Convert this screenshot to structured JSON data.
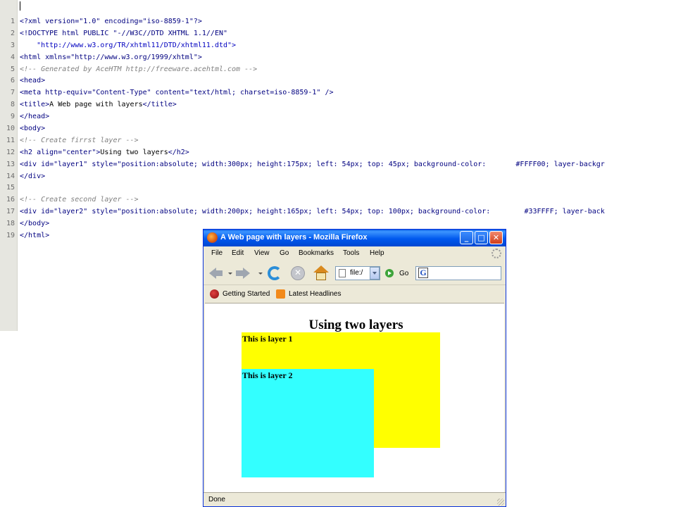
{
  "editor": {
    "lines": [
      {
        "n": "1",
        "parts": [
          {
            "cls": "c-tag",
            "t": "<?xml version=\"1.0\" encoding=\"iso-8859-1\"?>"
          }
        ]
      },
      {
        "n": "2",
        "parts": [
          {
            "cls": "c-tag",
            "t": "<!DOCTYPE html PUBLIC \"-//W3C//DTD XHTML 1.1//EN\""
          }
        ]
      },
      {
        "n": "3",
        "parts": [
          {
            "cls": "c-str",
            "t": "    \"http://www.w3.org/TR/xhtml11/DTD/xhtml11.dtd\">"
          }
        ]
      },
      {
        "n": "4",
        "parts": [
          {
            "cls": "c-tag",
            "t": "<html xmlns=\"http://www.w3.org/1999/xhtml\">"
          }
        ]
      },
      {
        "n": "5",
        "parts": [
          {
            "cls": "c-com",
            "t": "<!-- Generated by AceHTM http://freeware.acehtml.com -->"
          }
        ]
      },
      {
        "n": "6",
        "parts": [
          {
            "cls": "c-tag",
            "t": "<head>"
          }
        ]
      },
      {
        "n": "7",
        "parts": [
          {
            "cls": "c-tag",
            "t": "<meta http-equiv=\"Content-Type\" content=\"text/html; charset=iso-8859-1\" />"
          }
        ]
      },
      {
        "n": "8",
        "parts": [
          {
            "cls": "c-tag",
            "t": "<title>"
          },
          {
            "cls": "c-txt",
            "t": "A Web page with layers"
          },
          {
            "cls": "c-tag",
            "t": "</title>"
          }
        ]
      },
      {
        "n": "9",
        "parts": [
          {
            "cls": "c-tag",
            "t": "</head>"
          }
        ]
      },
      {
        "n": "10",
        "parts": [
          {
            "cls": "c-tag",
            "t": "<body>"
          }
        ]
      },
      {
        "n": "11",
        "parts": [
          {
            "cls": "c-com",
            "t": "<!-- Create firrst layer -->"
          }
        ]
      },
      {
        "n": "12",
        "parts": [
          {
            "cls": "c-tag",
            "t": "<h2 align=\"center\">"
          },
          {
            "cls": "c-txt",
            "t": "Using two layers"
          },
          {
            "cls": "c-tag",
            "t": "</h2>"
          }
        ]
      },
      {
        "n": "13",
        "parts": [
          {
            "cls": "c-tag",
            "t": "<div id=\"layer1\" style=\"position:absolute; width:300px; height:175px; left: 54px; top: 45px; background-color:       #FFFF00; layer-backgr"
          }
        ]
      },
      {
        "n": "14",
        "parts": [
          {
            "cls": "c-tag",
            "t": "</div>"
          }
        ]
      },
      {
        "n": "15",
        "parts": [
          {
            "cls": "c-txt",
            "t": ""
          }
        ]
      },
      {
        "n": "16",
        "parts": [
          {
            "cls": "c-com",
            "t": "<!-- Create second layer -->"
          }
        ]
      },
      {
        "n": "17",
        "parts": [
          {
            "cls": "c-tag",
            "t": "<div id=\"layer2\" style=\"position:absolute; width:200px; height:165px; left: 54px; top: 100px; background-color:        #33FFFF; layer-back"
          }
        ]
      },
      {
        "n": "18",
        "parts": [
          {
            "cls": "c-tag",
            "t": "</body>"
          }
        ]
      },
      {
        "n": "19",
        "parts": [
          {
            "cls": "c-tag",
            "t": "</html>"
          }
        ]
      }
    ]
  },
  "browser": {
    "title": "A Web page with layers - Mozilla Firefox",
    "window_buttons": {
      "minimize": "_",
      "maximize": "□",
      "close": "✕"
    },
    "menu": [
      "File",
      "Edit",
      "View",
      "Go",
      "Bookmarks",
      "Tools",
      "Help"
    ],
    "url": "file:/",
    "go_label": "Go",
    "search_icon_letter": "G",
    "stop_symbol": "✕",
    "bookmarks": [
      {
        "label": "Getting Started",
        "icon": "firefox-icon"
      },
      {
        "label": "Latest Headlines",
        "icon": "rss-icon"
      }
    ],
    "page": {
      "heading": "Using two layers",
      "layer1": {
        "text": "This is layer 1",
        "color": "#FFFF00"
      },
      "layer2": {
        "text": "This is layer 2",
        "color": "#33FFFF"
      }
    },
    "status": "Done"
  }
}
